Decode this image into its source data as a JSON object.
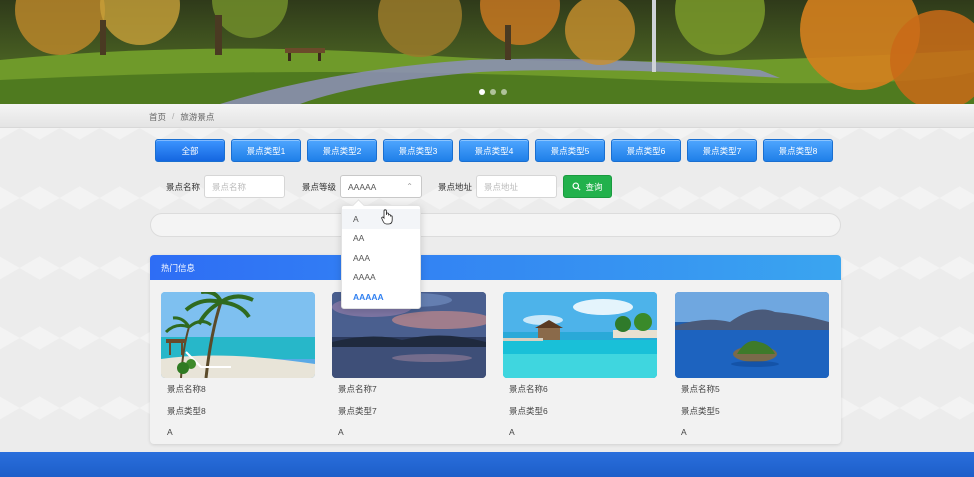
{
  "banner": {
    "dots": 3,
    "active_dot": 0
  },
  "breadcrumb": {
    "home": "首页",
    "sep": "/",
    "current": "旅游景点"
  },
  "categories": [
    "全部",
    "景点类型1",
    "景点类型2",
    "景点类型3",
    "景点类型4",
    "景点类型5",
    "景点类型6",
    "景点类型7",
    "景点类型8"
  ],
  "search": {
    "name_label": "景点名称",
    "name_placeholder": "景点名称",
    "level_label": "景点等级",
    "level_value": "AAAAA",
    "address_label": "景点地址",
    "address_placeholder": "景点地址",
    "query_label": "查询"
  },
  "level_options": [
    "A",
    "AA",
    "AAA",
    "AAAA",
    "AAAAA"
  ],
  "hot": {
    "title": "热门信息",
    "cards": [
      {
        "name": "景点名称8",
        "type": "景点类型8",
        "level": "A"
      },
      {
        "name": "景点名称7",
        "type": "景点类型7",
        "level": "A"
      },
      {
        "name": "景点名称6",
        "type": "景点类型6",
        "level": "A"
      },
      {
        "name": "景点名称5",
        "type": "景点类型5",
        "level": "A"
      }
    ]
  },
  "colors": {
    "primary": "#1f7fe8",
    "query_green": "#22b14c",
    "selected_option": "#2f7ff0",
    "footer": "#2a6fdc"
  }
}
